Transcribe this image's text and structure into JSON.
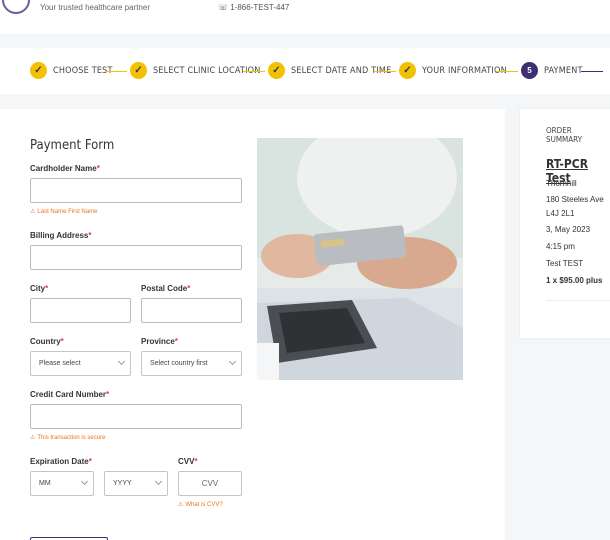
{
  "header": {
    "brand_subtitle": "Your trusted healthcare partner",
    "phone": "1-866-TEST-447"
  },
  "steps": [
    {
      "label": "CHOOSE TEST",
      "state": "done",
      "icon": "check-icon"
    },
    {
      "label": "SELECT CLINIC LOCATION",
      "state": "done",
      "icon": "check-icon"
    },
    {
      "label": "SELECT DATE AND TIME",
      "state": "done",
      "icon": "check-icon"
    },
    {
      "label": "YOUR INFORMATION",
      "state": "done",
      "icon": "check-icon"
    },
    {
      "label": "PAYMENT",
      "state": "active",
      "number": "5"
    }
  ],
  "form": {
    "title": "Payment Form",
    "cardholder_label": "Cardholder Name",
    "cardholder_hint": "Last Name First Name",
    "billing_label": "Billing Address",
    "city_label": "City",
    "postal_label": "Postal Code",
    "country_label": "Country",
    "country_value": "Please select",
    "province_label": "Province",
    "province_value": "Select country first",
    "cc_label": "Credit Card Number",
    "cc_hint": "This transaction is secure",
    "exp_label": "Expiration Date",
    "exp_month": "MM",
    "exp_year": "YYYY",
    "cvv_label": "CVV",
    "cvv_placeholder": "CVV",
    "cvv_hint": "What is CVV?",
    "required_mark": "*"
  },
  "summary": {
    "title": "ORDER SUMMARY",
    "test_name": "RT-PCR Test",
    "location": "Thornhill",
    "address": "180 Steeles Ave",
    "postal": "L4J 2L1",
    "date": "3, May 2023",
    "time": "4:15 pm",
    "patient": "Test TEST",
    "price": "1 x $95.00 plus"
  },
  "colors": {
    "accent": "#f2c200",
    "brand": "#3d2f73",
    "required": "#e23c3c",
    "hint": "#e8731a"
  }
}
